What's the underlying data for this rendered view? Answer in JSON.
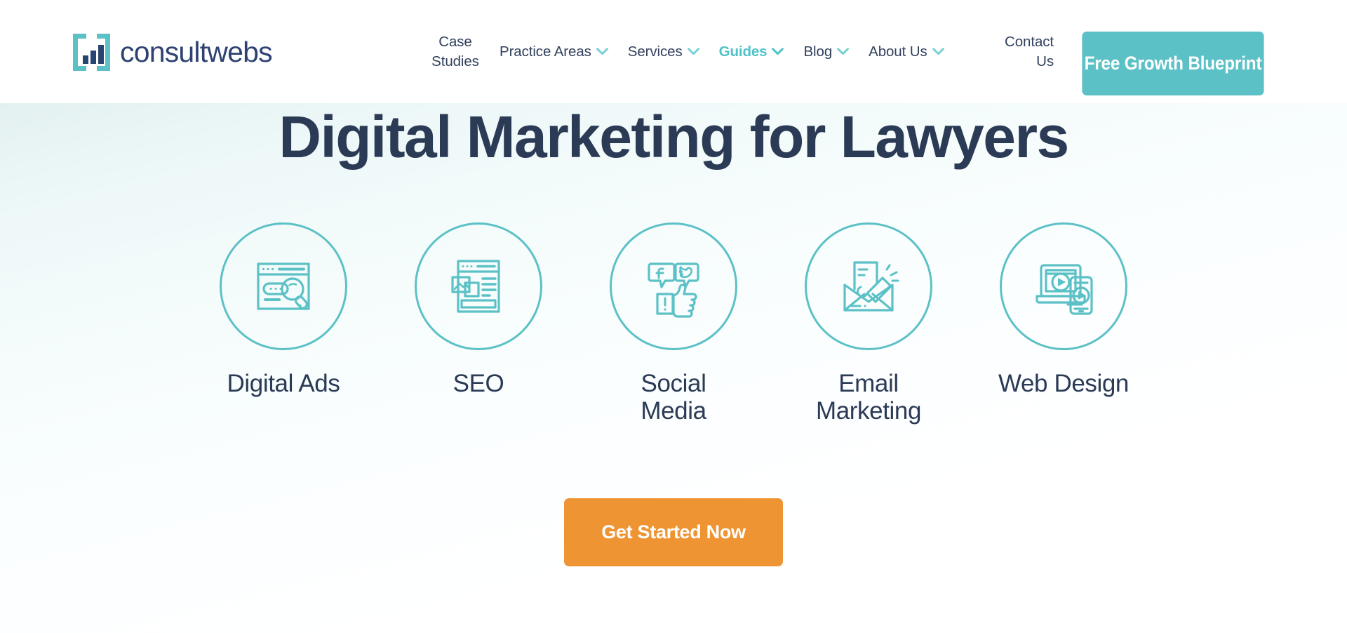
{
  "brand": {
    "logo_text": "consultwebs",
    "logo_mark_icon": "bar-chart-bracket-icon",
    "navy": "#2e4272",
    "teal": "#5cc1c6",
    "orange": "#ef9433",
    "heading_navy": "#2b3a55"
  },
  "nav": {
    "items": [
      {
        "label": "Case Studies",
        "has_dropdown": false,
        "two_line": true,
        "active": false,
        "chevron_icon": ""
      },
      {
        "label": "Practice Areas",
        "has_dropdown": true,
        "two_line": false,
        "active": false,
        "chevron_icon": "chevron-down-icon"
      },
      {
        "label": "Services",
        "has_dropdown": true,
        "two_line": false,
        "active": false,
        "chevron_icon": "chevron-down-icon"
      },
      {
        "label": "Guides",
        "has_dropdown": true,
        "two_line": false,
        "active": true,
        "chevron_icon": "chevron-down-icon"
      },
      {
        "label": "Blog",
        "has_dropdown": true,
        "two_line": false,
        "active": false,
        "chevron_icon": "chevron-down-icon"
      },
      {
        "label": "About Us",
        "has_dropdown": true,
        "two_line": false,
        "active": false,
        "chevron_icon": "chevron-down-icon"
      }
    ],
    "contact": {
      "label": "Contact Us"
    },
    "cta": {
      "label": "Free Growth Blueprint"
    }
  },
  "hero": {
    "title": "Digital Marketing for Lawyers",
    "cta": {
      "label": "Get Started Now"
    },
    "services": [
      {
        "label": "Digital Ads",
        "icon": "browser-search-ad-icon"
      },
      {
        "label": "SEO",
        "icon": "webpage-content-layout-icon"
      },
      {
        "label": "Social Media",
        "icon": "social-bubbles-thumbsup-icon"
      },
      {
        "label": "Email Marketing",
        "icon": "envelope-megaphone-icon"
      },
      {
        "label": "Web Design",
        "icon": "laptop-phone-play-icon"
      }
    ]
  }
}
